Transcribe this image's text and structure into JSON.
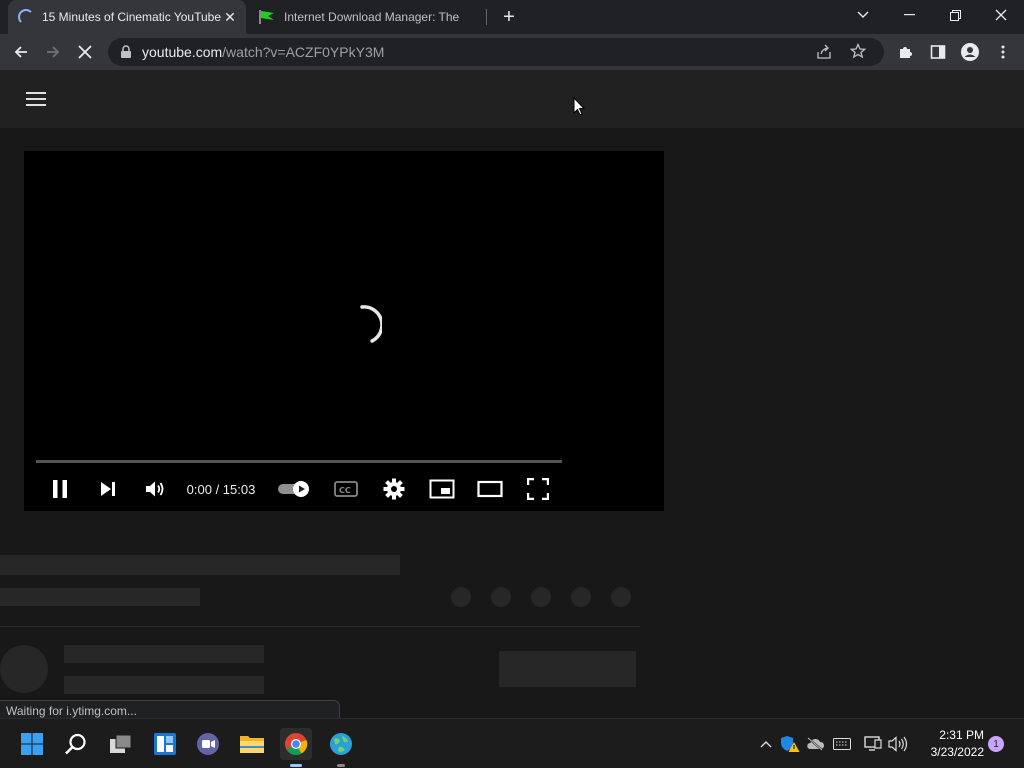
{
  "browser": {
    "tabs": [
      {
        "title": "15 Minutes of Cinematic YouTube",
        "close": "✕"
      },
      {
        "title": "Internet Download Manager: The",
        "close": "✕"
      }
    ],
    "new_tab": "+",
    "window_controls": {
      "tab_search": "⌄",
      "minimize": "—",
      "restore": "❐",
      "close": "✕"
    },
    "url_host": "youtube.com",
    "url_path": "/watch?v=ACZF0YPkY3M"
  },
  "player": {
    "time_current": "0:00",
    "time_total": "15:03",
    "time_text": "0:00 / 15:03"
  },
  "status_bar": {
    "text": "Waiting for i.ytimg.com..."
  },
  "taskbar": {
    "time": "2:31 PM",
    "date": "3/23/2022",
    "notification_count": "1"
  },
  "colors": {
    "accent": "#8ab4f8",
    "idm_green": "#1fd11f"
  }
}
